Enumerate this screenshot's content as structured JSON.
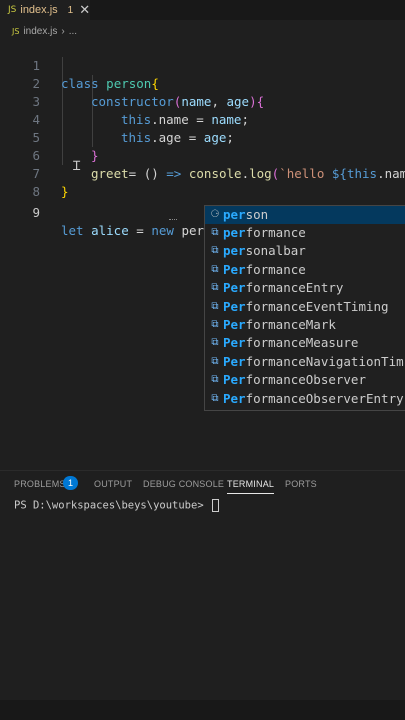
{
  "tab": {
    "icon": "JS",
    "filename": "index.js",
    "problems_count": "1",
    "close": "✕"
  },
  "breadcrumb": {
    "icon": "JS",
    "file": "index.js",
    "sep": "›",
    "rest": "..."
  },
  "editor": {
    "line_numbers": [
      "1",
      "2",
      "3",
      "4",
      "5",
      "6",
      "7",
      "8",
      "9"
    ],
    "lines": [
      {
        "kw": "class",
        "sp": " ",
        "name": "person",
        "br": "{"
      },
      {
        "fn": "constructor",
        "p1": "(",
        "a": "name",
        "c": ", ",
        "b": "age",
        "p2": "){"
      },
      {
        "kw": "this",
        "rest": ".name = ",
        "v": "name",
        "end": ";"
      },
      {
        "kw": "this",
        "rest": ".age = ",
        "v": "age",
        "end": ";"
      },
      {
        "br": "}"
      },
      {
        "fn": "greet",
        "eq": "= () ",
        "arrow": "=>",
        "sp": " ",
        "obj": "console",
        "dot": ".",
        "log": "log",
        "paren": "(",
        "str": "`hello ",
        "tpl": "${",
        "this": "this",
        "rest": ".nam"
      },
      {
        "br": "}"
      },
      {},
      {
        "kw": "let",
        "sp": " ",
        "v": "alice",
        "eq": " = ",
        "new": "new",
        "sp2": " ",
        "typed": "per"
      }
    ]
  },
  "suggestions": {
    "typed_prefix": "per",
    "items": [
      {
        "icon": "class",
        "match": "per",
        "rest": "son"
      },
      {
        "icon": "var",
        "match": "per",
        "rest": "formance"
      },
      {
        "icon": "var",
        "match": "per",
        "rest": "sonalbar"
      },
      {
        "icon": "var",
        "match": "Per",
        "rest": "formance"
      },
      {
        "icon": "var",
        "match": "Per",
        "rest": "formanceEntry"
      },
      {
        "icon": "var",
        "match": "Per",
        "rest": "formanceEventTiming"
      },
      {
        "icon": "var",
        "match": "Per",
        "rest": "formanceMark"
      },
      {
        "icon": "var",
        "match": "Per",
        "rest": "formanceMeasure"
      },
      {
        "icon": "var",
        "match": "Per",
        "rest": "formanceNavigationTim"
      },
      {
        "icon": "var",
        "match": "Per",
        "rest": "formanceObserver"
      },
      {
        "icon": "var",
        "match": "Per",
        "rest": "formanceObserverEntry"
      }
    ]
  },
  "panel": {
    "tabs": [
      "PROBLEMS",
      "OUTPUT",
      "DEBUG CONSOLE",
      "TERMINAL",
      "PORTS"
    ],
    "active_tab": "TERMINAL",
    "problems_badge": "1",
    "terminal_prompt": "PS D:\\workspaces\\beys\\youtube> "
  },
  "colors": {
    "accent": "#0078d4",
    "keyword": "#569cd6",
    "class": "#4ec9b0",
    "function": "#dcdcaa",
    "string": "#ce9178"
  }
}
